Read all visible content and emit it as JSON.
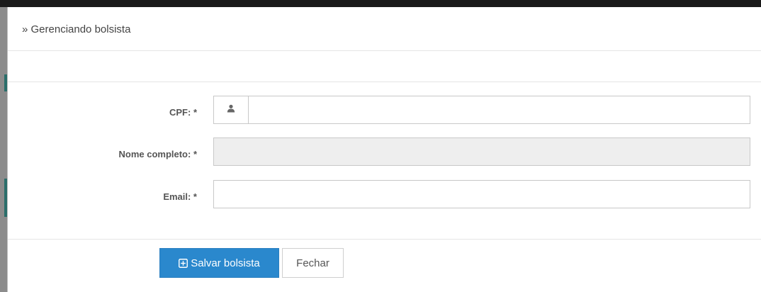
{
  "header": {
    "title": "» Gerenciando bolsista"
  },
  "form": {
    "cpf_label": "CPF: *",
    "cpf_value": "",
    "nome_label": "Nome completo: *",
    "nome_value": "",
    "email_label": "Email: *",
    "email_value": ""
  },
  "footer": {
    "save_label": "Salvar bolsista",
    "close_label": "Fechar"
  },
  "colors": {
    "primary": "#2a88cd",
    "disabled_bg": "#eeeeee"
  },
  "icons": {
    "cpf_addon": "user-icon",
    "save": "plus-square-icon"
  }
}
